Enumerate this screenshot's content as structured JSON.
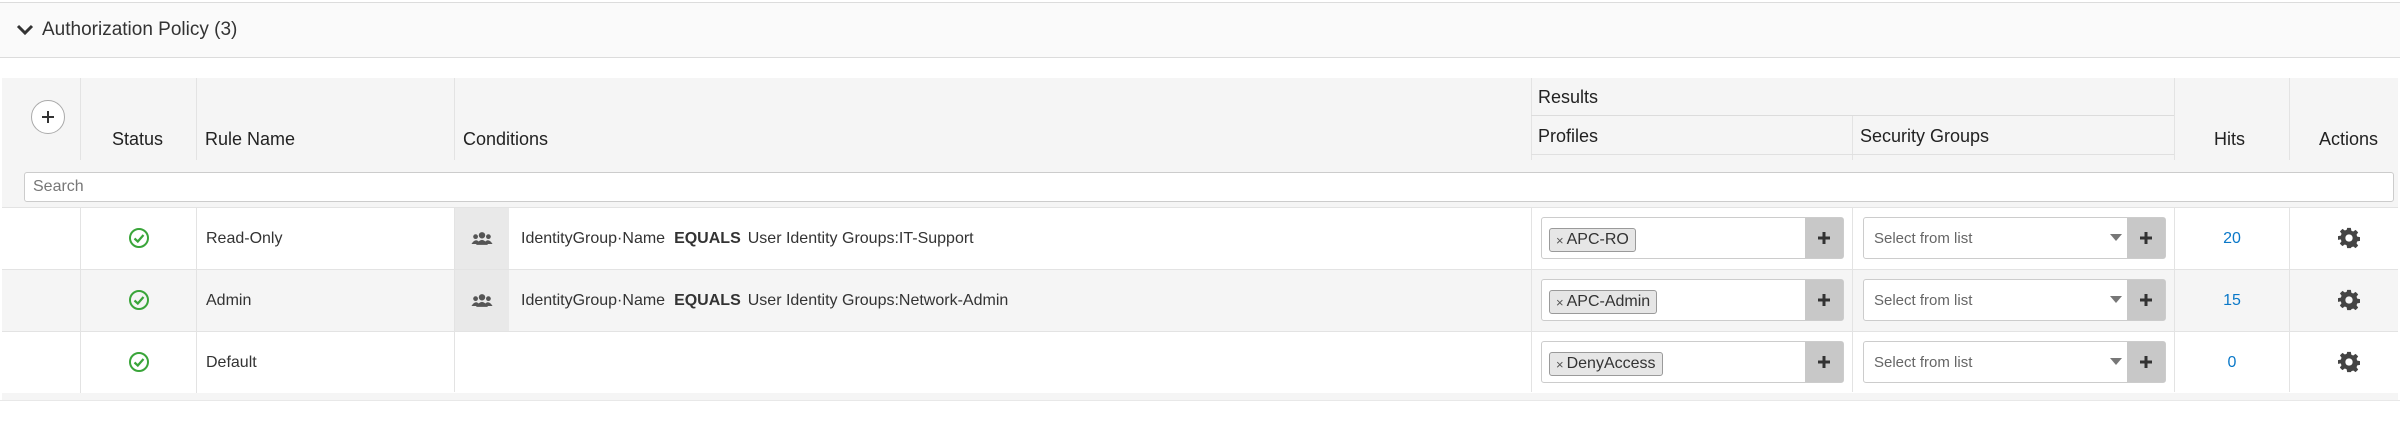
{
  "section": {
    "title": "Authorization Policy (3)",
    "icon": "chevron-down-icon"
  },
  "columns": {
    "status": "Status",
    "rule_name": "Rule Name",
    "conditions": "Conditions",
    "results": "Results",
    "profiles": "Profiles",
    "security_groups": "Security Groups",
    "hits": "Hits",
    "actions": "Actions"
  },
  "add_button": {
    "icon": "plus-icon",
    "label": "+"
  },
  "search": {
    "placeholder": "Search",
    "value": ""
  },
  "rules": [
    {
      "status": "enabled",
      "name": "Read-Only",
      "condition": {
        "attribute": "IdentityGroup·Name",
        "operator": "EQUALS",
        "value": "User Identity Groups:IT-Support",
        "icon": "identity-group-icon"
      },
      "profile_tag": "APC-RO",
      "security_group_placeholder": "Select from list",
      "hits": "20"
    },
    {
      "status": "enabled",
      "name": "Admin",
      "condition": {
        "attribute": "IdentityGroup·Name",
        "operator": "EQUALS",
        "value": "User Identity Groups:Network-Admin",
        "icon": "identity-group-icon"
      },
      "profile_tag": "APC-Admin",
      "security_group_placeholder": "Select from list",
      "hits": "15"
    },
    {
      "status": "enabled",
      "name": "Default",
      "condition": null,
      "profile_tag": "DenyAccess",
      "security_group_placeholder": "Select from list",
      "hits": "0"
    }
  ],
  "colors": {
    "status_ok": "#3aa53a",
    "hits_link": "#0a78c8",
    "gear": "#444444"
  }
}
